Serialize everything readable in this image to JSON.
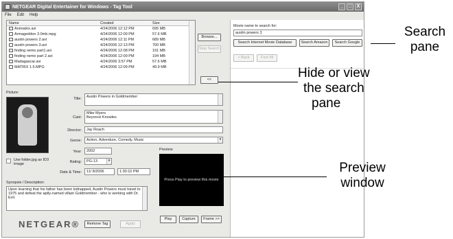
{
  "window": {
    "title": "NETGEAR Digital Entertainer for Windows - Tag Tool",
    "menu": [
      "File",
      "Edit",
      "Help"
    ],
    "controls": [
      "_",
      "□",
      "X"
    ]
  },
  "filelist": {
    "columns": [
      "Name",
      "Created",
      "Size"
    ],
    "rows": [
      {
        "name": "Animatrix.avi",
        "created": "4/24/2006 12:12 PM",
        "size": "695 MB"
      },
      {
        "name": "Armageddon 3.0mb.mpg",
        "created": "4/24/2006 12:09 PM",
        "size": "57.6 MB"
      },
      {
        "name": "austin powers 2.avi",
        "created": "4/24/2006 12:11 PM",
        "size": "689 MB"
      },
      {
        "name": "austin powers 3.avi",
        "created": "4/24/2006 12:13 PM",
        "size": "700 MB"
      },
      {
        "name": "finding nemo part1.avi",
        "created": "4/24/2006 12:08 PM",
        "size": "191 MB"
      },
      {
        "name": "finding nemo part 2.avi",
        "created": "4/24/2006 12:09 PM",
        "size": "194 MB"
      },
      {
        "name": "Madagascar.avi",
        "created": "4/24/2006 3:57 PM",
        "size": "57.6 MB"
      },
      {
        "name": "MATRIX 1.5.MPG",
        "created": "4/24/2006 12:09 PM",
        "size": "49.9 MB"
      }
    ]
  },
  "buttons": {
    "browse": "Browse...",
    "stop_search": "Stop Search",
    "collapse": "<<",
    "remove_tag": "Remove Tag",
    "apply": "Apply",
    "play": "Play",
    "capture": "Capture",
    "frame": "Frame >>"
  },
  "details": {
    "picture_label": "Picture:",
    "title_label": "Title:",
    "title_value": "Austin Powers in Goldmember",
    "cast_label": "Cast:",
    "cast_values": [
      "Mike Myers",
      "Beyoncé Knowles"
    ],
    "director_label": "Director:",
    "director_value": "Jay Roach",
    "genre_label": "Genre:",
    "genre_value": "Action, Adventure, Comedy, Music",
    "year_label": "Year:",
    "year_value": "2002",
    "rating_label": "Rating:",
    "rating_value": "PG-13",
    "date_label": "Date & Time:",
    "date_value": "11/ 8/2006",
    "time_value": "1:30:10 PM",
    "use_folder_label": "Use folder.jpg as ID3 image",
    "synopsis_label": "Synopsis / Description:",
    "synopsis_value": "Upon learning that his father has been kidnapped, Austin Powers must travel to 1975 and defeat the aptly-named villain Goldmember - who is working with Dr. Evil."
  },
  "preview": {
    "label": "Preview",
    "message": "Press Play to preview this movie"
  },
  "logo": "NETGEAR®",
  "search": {
    "label": "Movie name to search for:",
    "value": "austin powers 3",
    "btn_imdb": "Search Internet Movie Database",
    "btn_amazon": "Search Amazon",
    "btn_google": "Search Google",
    "back": "< Back",
    "forward": "Fore fill"
  },
  "callouts": {
    "search_pane": [
      "Search",
      "pane"
    ],
    "hide_view": [
      "Hide or view",
      "the search",
      "pane"
    ],
    "preview_window": [
      "Preview",
      "window"
    ]
  }
}
